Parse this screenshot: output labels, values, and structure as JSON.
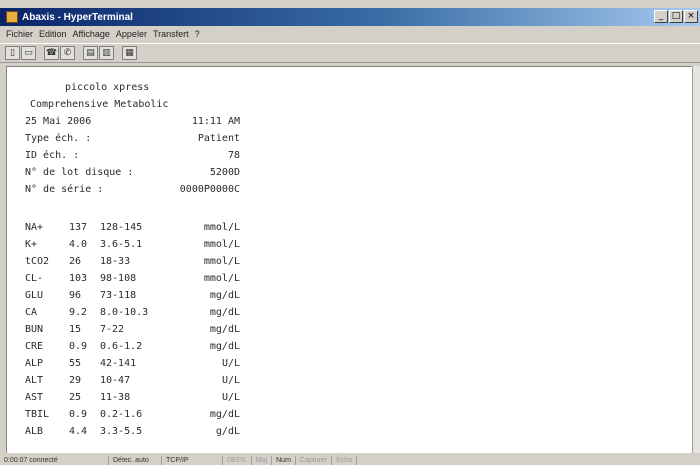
{
  "window": {
    "title": "Abaxis - HyperTerminal",
    "controls": [
      "_",
      "□",
      "×"
    ]
  },
  "menu": [
    "Fichier",
    "Edition",
    "Affichage",
    "Appeler",
    "Transfert",
    "?"
  ],
  "toolbar": {
    "buttons": [
      {
        "icon": "new-document-icon",
        "glyph": "▯"
      },
      {
        "icon": "open-folder-icon",
        "glyph": "▭"
      },
      {
        "icon": "phone-connect-icon",
        "glyph": "☎"
      },
      {
        "icon": "phone-disconnect-icon",
        "glyph": "✆"
      },
      {
        "icon": "send-file-icon",
        "glyph": "▤"
      },
      {
        "icon": "receive-file-icon",
        "glyph": "▥"
      },
      {
        "icon": "properties-icon",
        "glyph": "▦"
      }
    ]
  },
  "report": {
    "device": "piccolo xpress",
    "panel": "Comprehensive Metabolic",
    "date": "25 Mai 2006",
    "time": "11:11 AM",
    "sample_type_label": "Type éch. :",
    "sample_type": "Patient",
    "sample_id_label": "ID éch. :",
    "sample_id": "78",
    "lot_label": "N° de lot disque :",
    "lot": "5200D",
    "serial_label": "N° de série :",
    "serial": "0000P0000C",
    "results": [
      {
        "analyte": "NA+",
        "value": "137",
        "range": "128-145",
        "unit": "mmol/L"
      },
      {
        "analyte": "K+",
        "value": "4.0",
        "range": "3.6-5.1",
        "unit": "mmol/L"
      },
      {
        "analyte": "tCO2",
        "value": "26",
        "range": "18-33",
        "unit": "mmol/L"
      },
      {
        "analyte": "CL-",
        "value": "103",
        "range": "98-108",
        "unit": "mmol/L"
      },
      {
        "analyte": "GLU",
        "value": "96",
        "range": "73-118",
        "unit": "mg/dL"
      },
      {
        "analyte": "CA",
        "value": "9.2",
        "range": "8.0-10.3",
        "unit": "mg/dL"
      },
      {
        "analyte": "BUN",
        "value": "15",
        "range": "7-22",
        "unit": "mg/dL"
      },
      {
        "analyte": "CRE",
        "value": "0.9",
        "range": "0.6-1.2",
        "unit": "mg/dL"
      },
      {
        "analyte": "ALP",
        "value": "55",
        "range": "42-141",
        "unit": "U/L"
      },
      {
        "analyte": "ALT",
        "value": "29",
        "range": "10-47",
        "unit": "U/L"
      },
      {
        "analyte": "AST",
        "value": "25",
        "range": "11-38",
        "unit": "U/L"
      },
      {
        "analyte": "TBIL",
        "value": "0.9",
        "range": "0.2-1.6",
        "unit": "mg/dL"
      },
      {
        "analyte": "ALB",
        "value": "4.4",
        "range": "3.3-5.5",
        "unit": "g/dL"
      }
    ]
  },
  "status": {
    "time": "0:00:07 connecté",
    "detect": "Détec. auto",
    "protocol": "TCP/IP",
    "flags": [
      "DEFIL",
      "Maj",
      "Num",
      "Capturer",
      "Écho"
    ]
  }
}
